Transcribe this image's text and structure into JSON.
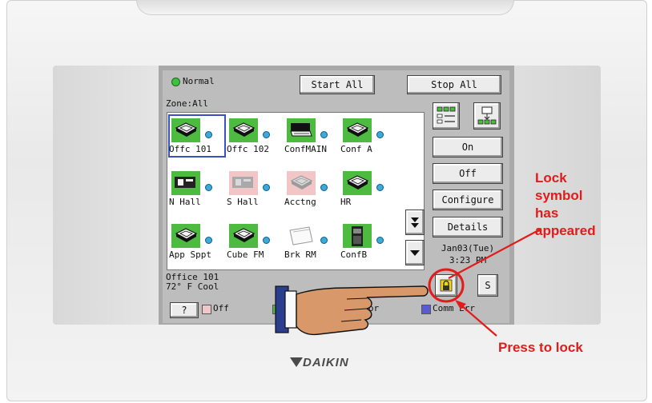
{
  "header": {
    "status_label": "Normal",
    "start_all": "Start All",
    "stop_all": "Stop All",
    "zone": "Zone:All"
  },
  "units": [
    {
      "label": "Offc 101",
      "state": "on",
      "type": "cassette",
      "selected": true
    },
    {
      "label": "Offc 102",
      "state": "on",
      "type": "cassette"
    },
    {
      "label": "ConfMAIN",
      "state": "on",
      "type": "duct"
    },
    {
      "label": "Conf A",
      "state": "on",
      "type": "cassette"
    },
    {
      "label": "N Hall",
      "state": "on",
      "type": "wall"
    },
    {
      "label": "S Hall",
      "state": "off",
      "type": "wall"
    },
    {
      "label": "Acctng",
      "state": "off",
      "type": "cassette"
    },
    {
      "label": "HR",
      "state": "on",
      "type": "cassette"
    },
    {
      "label": "App Sppt",
      "state": "on",
      "type": "cassette"
    },
    {
      "label": "Cube FM",
      "state": "on",
      "type": "cassette"
    },
    {
      "label": "Brk RM",
      "state": "off",
      "type": "panel"
    },
    {
      "label": "ConfB",
      "state": "on",
      "type": "floor"
    }
  ],
  "selected_status": {
    "name": "Office 101",
    "detail": "72° F  Cool"
  },
  "side_buttons": {
    "on": "On",
    "off": "Off",
    "configure": "Configure",
    "details": "Details"
  },
  "clock": {
    "date": "Jan03(Tue)",
    "time": "3:23 PM"
  },
  "schedule_button": "S",
  "help_button": "?",
  "legend": [
    {
      "label": "Off",
      "color": "#f2c6c6"
    },
    {
      "label": "On",
      "color": "#4dbb3f"
    },
    {
      "label": "Error",
      "color": "#ffffff"
    },
    {
      "label": "Comm Err",
      "color": "#5a5ad2"
    }
  ],
  "colors": {
    "on": "#4dbb3f",
    "off": "#f2c6c6",
    "annotation": "#e21b1b"
  },
  "annotations": {
    "lock_text": [
      "Lock",
      "symbol",
      "has",
      "appeared"
    ],
    "press_text": "Press to lock"
  },
  "brand": "DAIKIN"
}
